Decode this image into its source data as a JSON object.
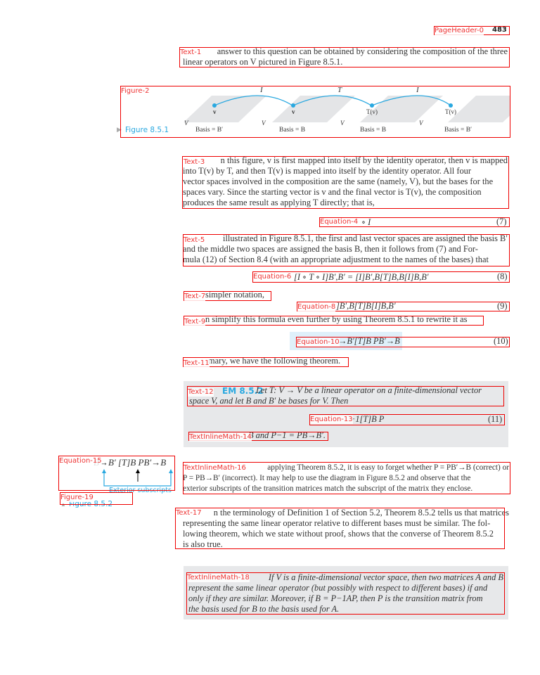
{
  "header": {
    "page_number": "483",
    "label": "PageHeader-0"
  },
  "text1": {
    "label": "Text-1",
    "lines": [
      "answer to this question can be obtained by considering the composition of the three",
      "linear operators on V pictured in Figure 8.5.1."
    ]
  },
  "figure2": {
    "label": "Figure-2",
    "caption": "Figure 8.5.1",
    "operators": [
      "I",
      "T",
      "I"
    ],
    "points": [
      "v",
      "v",
      "T(v)",
      "T(v)"
    ],
    "space": "V",
    "bases": [
      "Basis = B′",
      "Basis = B",
      "Basis = B",
      "Basis = B′"
    ]
  },
  "text3": {
    "label": "Text-3",
    "lines": [
      "n this figure, v is first mapped into itself by the identity operator, then v is mapped",
      "into T(v) by T, and then T(v) is mapped into itself by the identity operator. All four",
      "vector spaces involved in the composition are the same (namely, V), but the bases for the",
      "spaces vary. Since the starting vector is v and the final vector is T(v), the composition",
      "produces the same result as applying T directly; that is,"
    ]
  },
  "eq4": {
    "label": "Equation-4",
    "expr": "∘ I",
    "number": "(7)"
  },
  "text5": {
    "label": "Text-5",
    "lines": [
      "illustrated in Figure 8.5.1, the first and last vector spaces are assigned the basis B′",
      "and the middle two spaces are assigned the basis B, then it follows from (7) and For-",
      "mula (12) of Section 8.4 (with an appropriate adjustment to the names of the bases) that"
    ]
  },
  "eq6": {
    "label": "Equation-6",
    "expr": "[I ∘ T ∘ I]B′,B′ = [I]B′,B[T]B,B[I]B,B′",
    "number": "(8)"
  },
  "text7": {
    "label": "Text-7",
    "text": "simpler notation,"
  },
  "eq8": {
    "label": "Equation-8",
    "expr": "]B′,B[T]B[I]B,B′",
    "number": "(9)"
  },
  "text9": {
    "label": "Text-9",
    "text": "n simplify this formula even further by using Theorem 8.5.1 to rewrite it as"
  },
  "eq10": {
    "label": "Equation-10",
    "expr": "→B′[T]B PB′→B",
    "number": "(10)"
  },
  "text11": {
    "label": "Text-11",
    "text": "mary, we have the following theorem."
  },
  "theorem1": {
    "label12": "Text-12",
    "heading": "EM 8.5.2",
    "lines": [
      "Let T: V → V be a linear operator on a finite-dimensional vector",
      "space V, and let B and B′ be bases for V. Then"
    ],
    "eq_label": "Equation-13",
    "eq_expr": "−1[T]B P",
    "eq_number": "(11)",
    "label14": "TextInlineMath-14",
    "tail": "B and P−1 = PB→B′."
  },
  "eq15": {
    "label": "Equation-15",
    "expr": "B→B′ [T]B PB′→B",
    "annotation": "Exterior subscripts"
  },
  "figure19": {
    "label": "Figure-19",
    "caption": "Figure 8.5.2"
  },
  "text16": {
    "label": "TextInlineMath-16",
    "lines": [
      "applying Theorem 8.5.2, it is easy to forget whether P = PB′→B (correct) or",
      "P = PB→B′ (incorrect). It may help to use the diagram in Figure 8.5.2 and observe that the",
      "exterior subscripts of the transition matrices match the subscript of the matrix they enclose."
    ]
  },
  "text17": {
    "label": "Text-17",
    "lines": [
      "n the terminology of Definition 1 of Section 5.2, Theorem 8.5.2 tells us that matrices",
      "representing the same linear operator relative to different bases must be similar. The fol-",
      "lowing theorem, which we state without proof, shows that the converse of Theorem 8.5.2",
      "is also true."
    ]
  },
  "theorem2": {
    "label": "TextInlineMath-18",
    "lines": [
      "If V is a finite-dimensional vector space, then two matrices A and B",
      "represent the same linear operator (but possibly with respect to different bases) if and",
      "only if they are similar. Moreover, if B = P−1AP, then P is the transition matrix from",
      "the basis used for B to the basis used for A."
    ]
  },
  "colors": {
    "accent": "#29a8e0",
    "annotation": "#e00000",
    "panel": "#e7e8ea"
  }
}
